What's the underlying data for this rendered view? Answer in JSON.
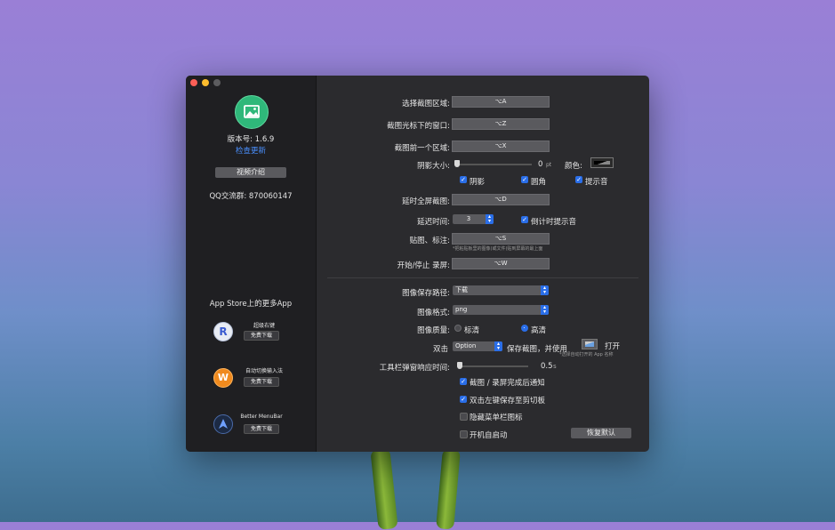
{
  "sidebar": {
    "version": "版本号: 1.6.9",
    "check_update": "检查更新",
    "video_intro": "视频介绍",
    "qq_group": "QQ交流群:  870060147",
    "more_apps_title": "App Store上的更多App",
    "apps": [
      {
        "name": "超级右键",
        "download": "免费下载",
        "icon": "right-click-icon"
      },
      {
        "name": "自动切换输入法",
        "download": "免费下载",
        "icon": "input-method-icon"
      },
      {
        "name": "Better MenuBar",
        "download": "免费下载",
        "icon": "menubar-icon"
      }
    ]
  },
  "shortcuts": {
    "region_label": "选择截图区域:",
    "region_key": "⌥A",
    "window_label": "截图光标下的窗口:",
    "window_key": "⌥Z",
    "previous_label": "截图前一个区域:",
    "previous_key": "⌥X"
  },
  "shadow": {
    "size_label": "阴影大小:",
    "size_value": 0,
    "size_display": "0",
    "unit": "pt",
    "color_label": "颜色:",
    "shadow_cb": "阴影",
    "round_cb": "圆角",
    "sound_cb": "提示音"
  },
  "delay": {
    "fullscreen_label": "延时全屏截图:",
    "fullscreen_key": "⌥D",
    "time_label": "延迟时间:",
    "time_value": "3",
    "countdown_cb": "倒计时提示音"
  },
  "pin": {
    "label": "贴图、标注:",
    "key": "⌥S",
    "note": "*把粘贴板里的图像(或文件)贴到屏幕的最上面"
  },
  "record": {
    "label": "开始/停止 录屏:",
    "key": "⌥W"
  },
  "save": {
    "path_label": "图像保存路径:",
    "path_value": "下载",
    "format_label": "图像格式:",
    "format_value": "png",
    "quality_label": "图像质量:",
    "quality_standard": "标清",
    "quality_high": "高清",
    "dbl_label": "双击",
    "dbl_modifier": "Option",
    "dbl_action": "保存截图，并使用",
    "dbl_open": "打开",
    "dbl_note": "*选择自动打开的 App 名称"
  },
  "toolbar": {
    "response_label": "工具栏弹窗响应时间:",
    "response_value": 0.5,
    "response_display": "0.5",
    "response_unit": "s"
  },
  "options": {
    "notify": "截图 / 录屏完成后通知",
    "dblclick_copy": "双击左键保存至剪切板",
    "hide_menubar": "隐藏菜单栏图标",
    "launch_at_login": "开机自启动",
    "restore": "恢复默认"
  },
  "colors": {
    "accent": "#2a6ee8",
    "logo": "#2fb87a",
    "link": "#4a90ff"
  }
}
